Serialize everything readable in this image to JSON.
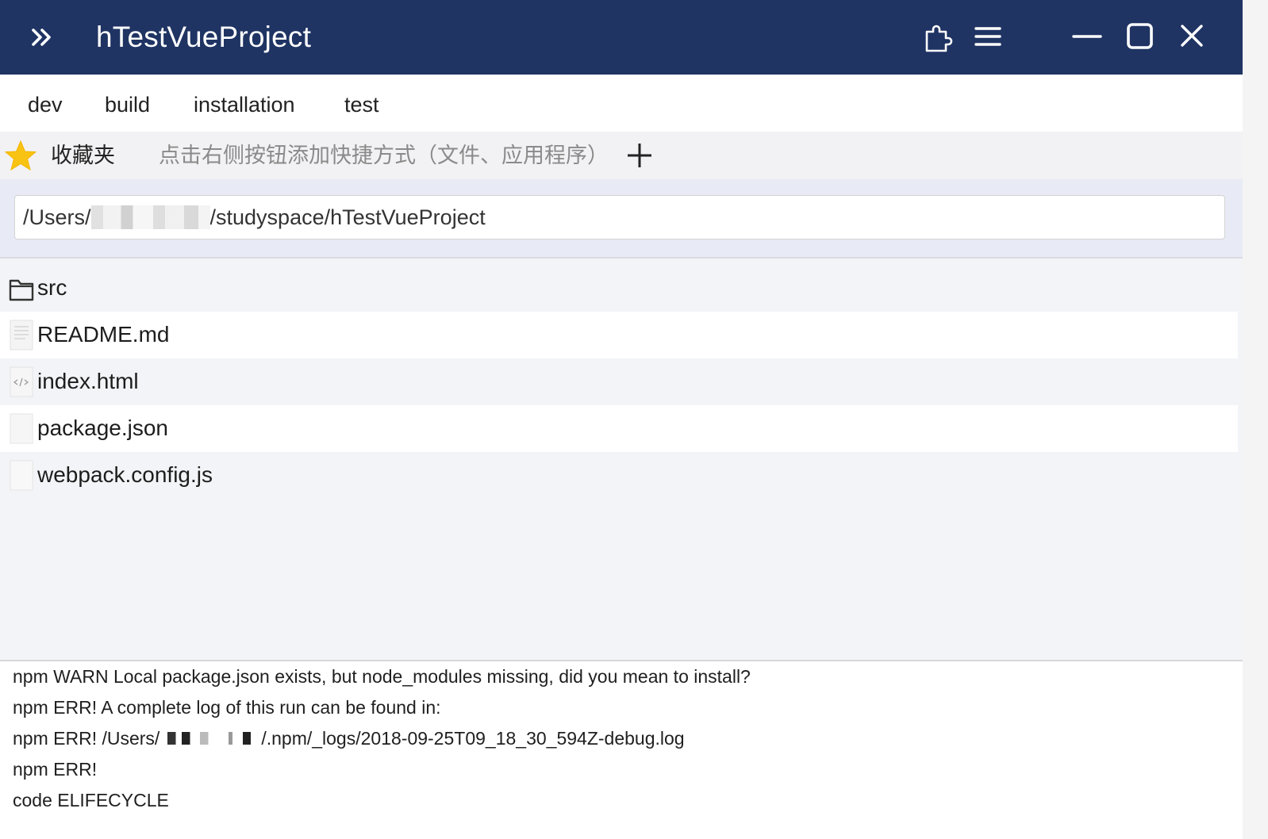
{
  "titlebar": {
    "title": "hTestVueProject",
    "expand_icon": "double-chevron-right-icon",
    "buttons": [
      "puzzle-icon",
      "hamburger-menu-icon",
      "minimize-icon",
      "maximize-icon",
      "close-icon"
    ],
    "background": "#1f3463"
  },
  "tabs": [
    "dev",
    "build",
    "installation",
    "test"
  ],
  "favorites": {
    "label": "收藏夹",
    "hint": "点击右侧按钮添加快捷方式（文件、应用程序）",
    "add_icon": "plus-icon",
    "star_color": "#f9c313"
  },
  "path": {
    "prefix": "/Users/",
    "suffix": "/studyspace/hTestVueProject"
  },
  "files": [
    {
      "name": "src",
      "icon": "folder-icon"
    },
    {
      "name": "README.md",
      "icon": "text-file-icon"
    },
    {
      "name": "index.html",
      "icon": "html-file-icon"
    },
    {
      "name": "package.json",
      "icon": "blank-file-icon"
    },
    {
      "name": "webpack.config.js",
      "icon": "blank-file-icon"
    }
  ],
  "console": {
    "lines": [
      "npm WARN Local package.json exists, but node_modules missing, did you mean to install?",
      "npm ERR! A complete log of this run can be found in:",
      "npm ERR!",
      "code ELIFECYCLE"
    ],
    "log_path_prefix": "npm ERR! /Users/",
    "log_path_suffix": "/.npm/_logs/2018-09-25T09_18_30_594Z-debug.log"
  }
}
